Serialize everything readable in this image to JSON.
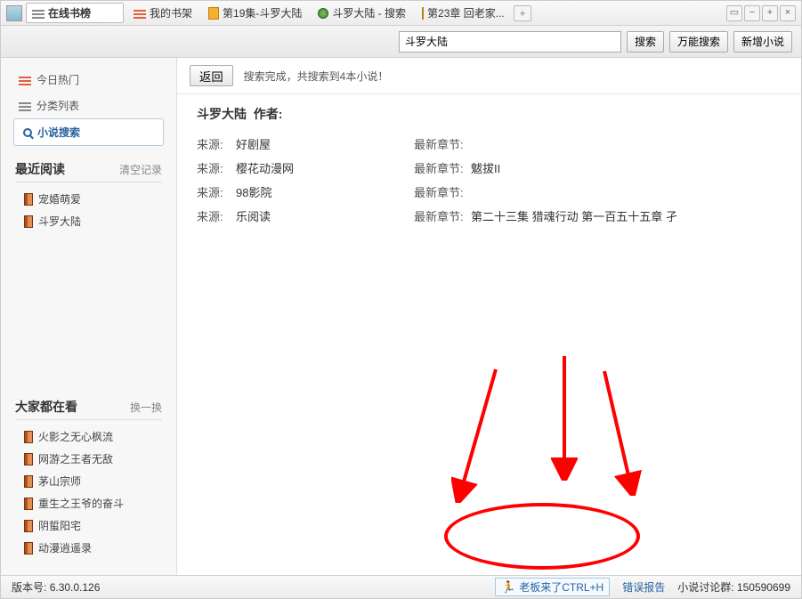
{
  "tabs": {
    "t0": "在线书榜",
    "t1": "我的书架",
    "t2": "第19集-斗罗大陆",
    "t3": "斗罗大陆 - 搜索",
    "t4": "第23章 回老家..."
  },
  "searchBar": {
    "value": "斗罗大陆",
    "btnSearch": "搜索",
    "btnPowerSearch": "万能搜索",
    "btnAddNovel": "新增小说"
  },
  "sidebar": {
    "nav": {
      "hot": "今日热门",
      "category": "分类列表",
      "search": "小说搜索"
    },
    "recent": {
      "title": "最近阅读",
      "action": "清空记录",
      "items": [
        "宠婚萌爱",
        "斗罗大陆"
      ]
    },
    "everyone": {
      "title": "大家都在看",
      "action": "换一换",
      "items": [
        "火影之无心枫流",
        "网游之王者无敌",
        "茅山宗师",
        "重生之王爷的奋斗",
        "阴蜇阳宅",
        "动漫逍遥录"
      ]
    }
  },
  "content": {
    "backBtn": "返回",
    "summary": "搜索完成，共搜索到4本小说！",
    "titlePrefix": "斗罗大陆",
    "titleAuthorLabel": "作者:",
    "sourceLabel": "来源:",
    "chapterLabel": "最新章节:",
    "rows": [
      {
        "source": "好剧屋",
        "chapter": ""
      },
      {
        "source": "樱花动漫网",
        "chapter": "魃拔II"
      },
      {
        "source": "98影院",
        "chapter": ""
      },
      {
        "source": "乐阅读",
        "chapter": "第二十三集 猎魂行动 第一百五十五章 孑"
      }
    ]
  },
  "statusBar": {
    "versionLabel": "版本号:",
    "version": "6.30.0.126",
    "bossKey": "老板来了CTRL+H",
    "bugReport": "错误报告",
    "groupLabel": "小说讨论群:",
    "groupNum": "150590699"
  }
}
